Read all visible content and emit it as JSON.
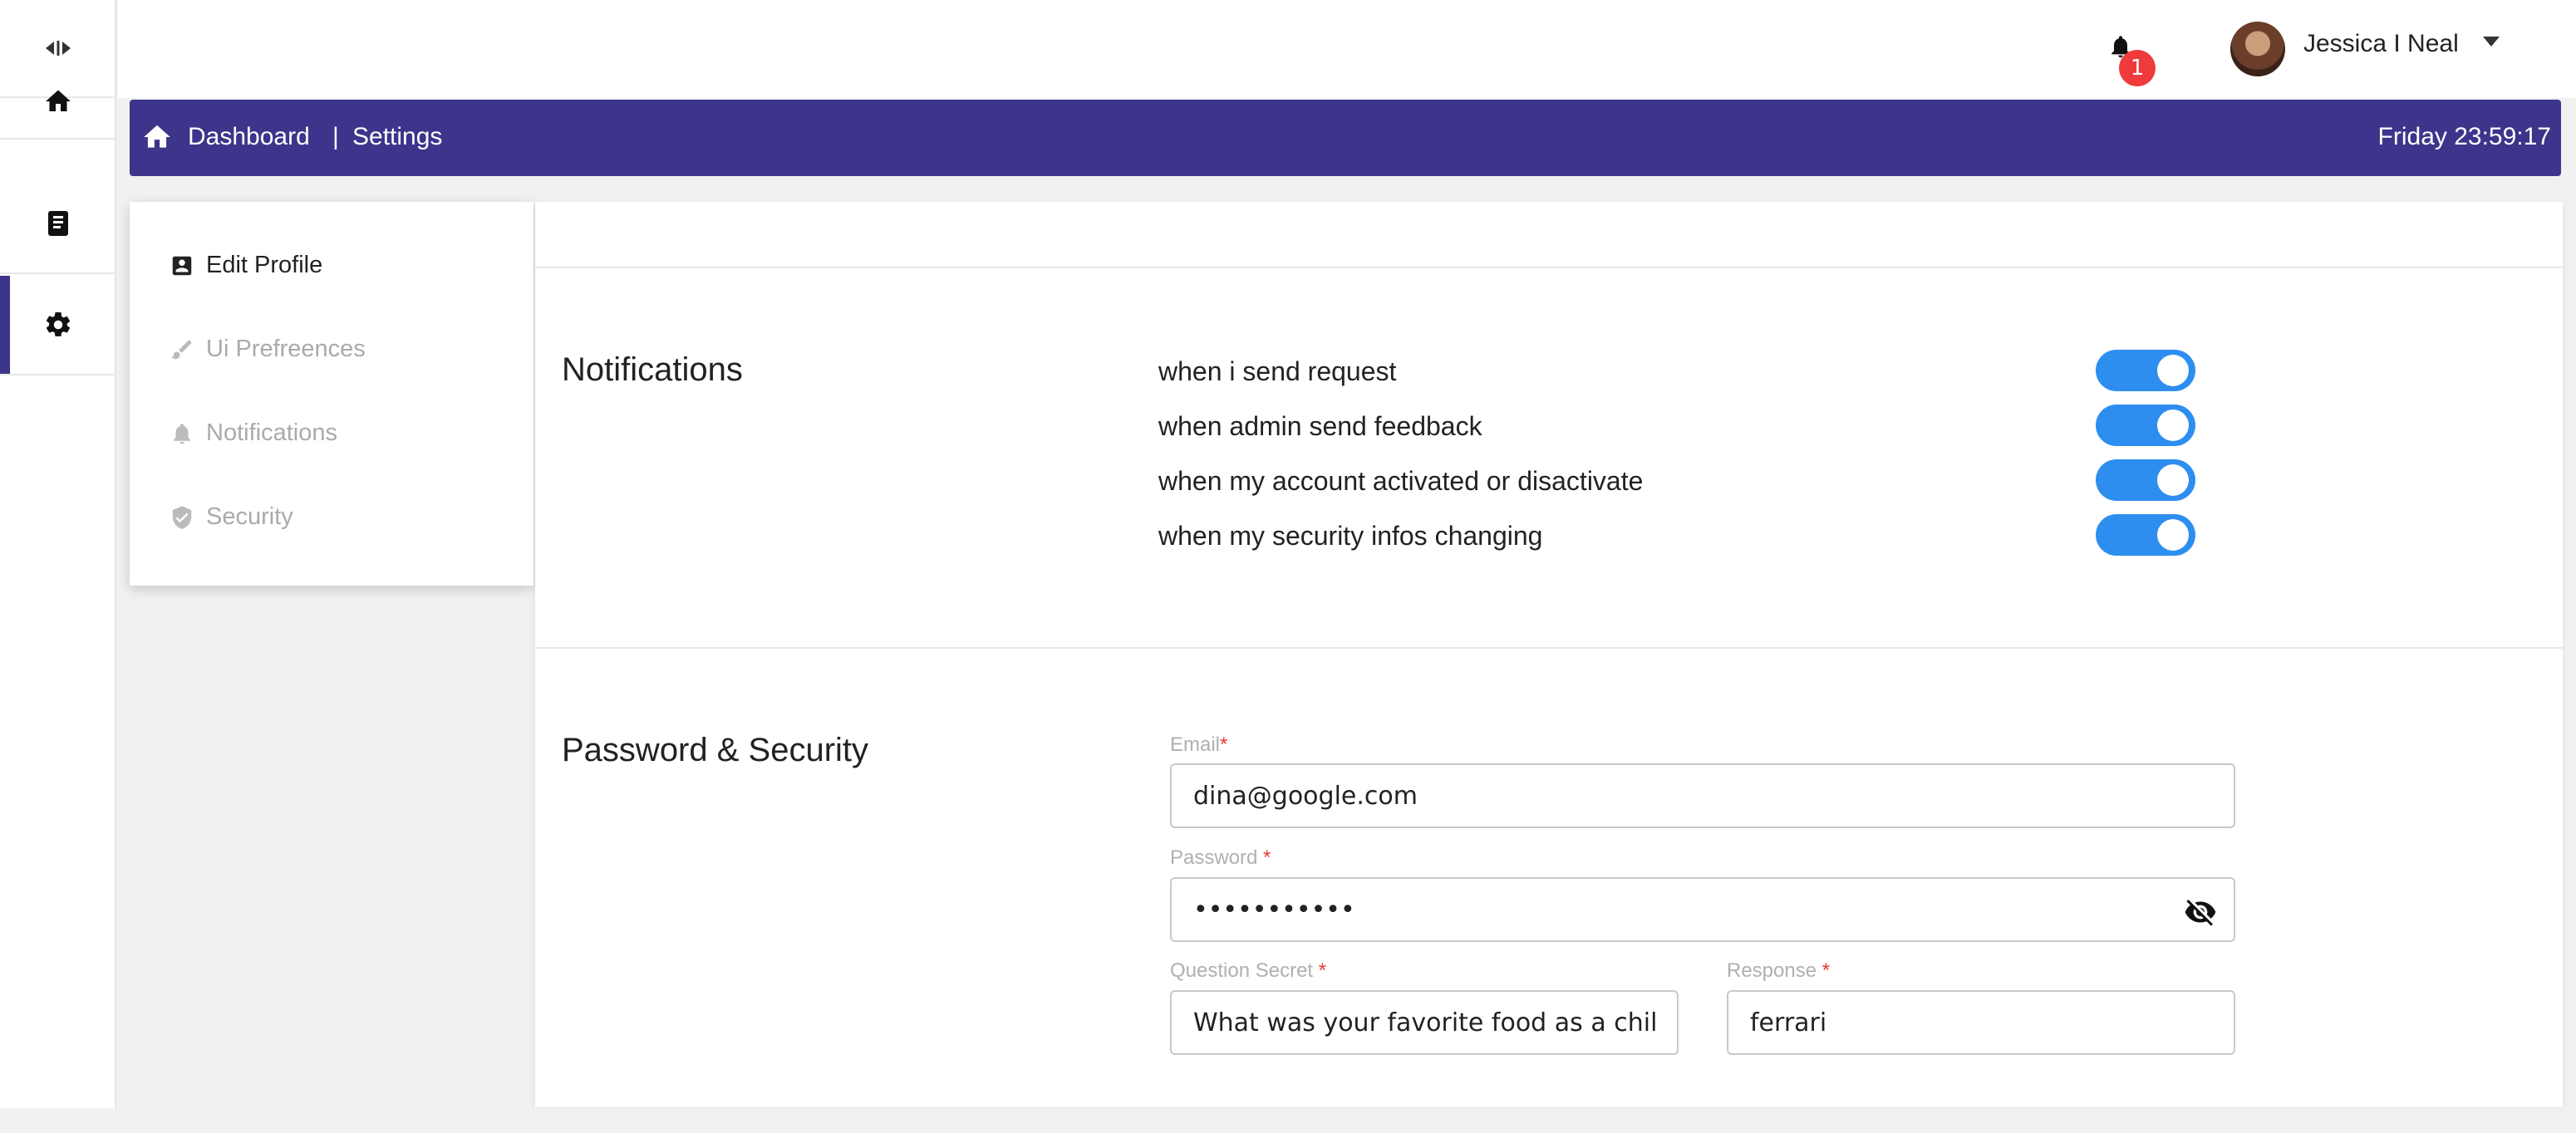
{
  "user": {
    "name": "Jessica I Neal",
    "notification_count": "1"
  },
  "breadcrumb": {
    "dashboard": "Dashboard",
    "separator": "|",
    "settings": "Settings",
    "clock": "Friday 23:59:17"
  },
  "rail": {
    "items": [
      "home-icon",
      "document-icon",
      "gear-icon"
    ],
    "active": "gear-icon",
    "accent": "#3d348b"
  },
  "settings_menu": {
    "items": [
      {
        "label": "Edit Profile",
        "icon": "profile-icon",
        "active": true
      },
      {
        "label": "Ui Prefreences",
        "icon": "brush-icon",
        "active": false
      },
      {
        "label": "Notifications",
        "icon": "bell-icon",
        "active": false
      },
      {
        "label": "Security",
        "icon": "shield-icon",
        "active": false
      }
    ]
  },
  "notifications": {
    "title": "Notifications",
    "options": [
      {
        "label": "when i send request",
        "enabled": true
      },
      {
        "label": "when admin send feedback",
        "enabled": true
      },
      {
        "label": "when my account activated or disactivate",
        "enabled": true
      },
      {
        "label": "when my security infos changing",
        "enabled": true
      }
    ],
    "toggle_color": "#2d8ef0"
  },
  "security": {
    "title": "Password & Security",
    "email": {
      "label": "Email",
      "required_mark": "*",
      "value": "dina@google.com"
    },
    "password": {
      "label": "Password",
      "required_mark": "*",
      "value": "•••••••••••"
    },
    "question": {
      "label": "Question Secret",
      "required_mark": "*",
      "value": "What was your favorite food as a child? h"
    },
    "response": {
      "label": "Response",
      "required_mark": "*",
      "value": "ferrari"
    }
  }
}
